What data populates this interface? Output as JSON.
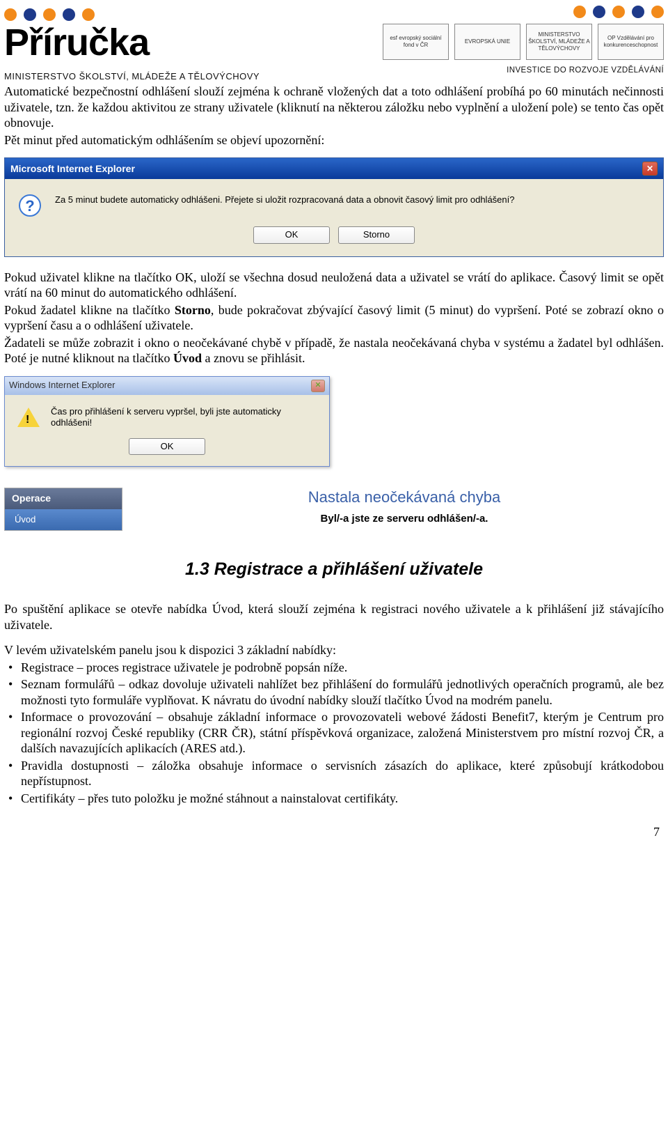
{
  "header": {
    "logo_text": "Příručka",
    "subtitle": "MINISTERSTVO ŠKOLSTVÍ, MLÁDEŽE A TĚLOVÝCHOVY",
    "invest_line": "INVESTICE DO ROZVOJE VZDĚLÁVÁNÍ",
    "sponsor_logos": [
      "esf evropský sociální fond v ČR",
      "EVROPSKÁ UNIE",
      "MINISTERSTVO ŠKOLSTVÍ, MLÁDEŽE A TĚLOVÝCHOVY",
      "OP Vzdělávání pro konkurenceschopnost"
    ]
  },
  "paras": {
    "p1": "Automatické bezpečnostní odhlášení slouží zejména k ochraně vložených dat a toto odhlášení probíhá po 60 minutách nečinnosti uživatele, tzn. že každou aktivitou ze strany uživatele (kliknutí na některou záložku nebo vyplnění a uložení pole) se tento čas opět obnovuje.",
    "p2": "Pět minut před automatickým odhlášením se objeví upozornění:",
    "p3a": "Pokud uživatel klikne na tlačítko OK, uloží se všechna dosud neuložená data a uživatel se vrátí do aplikace. Časový limit se opět vrátí na 60 minut do automatického odhlášení.",
    "p3b_pre": "Pokud žadatel klikne na tlačítko ",
    "p3b_bold": "Storno",
    "p3b_post": ", bude pokračovat zbývající časový limit (5 minut) do vypršení. Poté se zobrazí okno o vypršení času a o odhlášení uživatele.",
    "p3c_pre": "Žadateli se může zobrazit i okno o neočekávané chybě v případě, že nastala neočekávaná chyba v systému a žadatel byl odhlášen. Poté je nutné kliknout na tlačítko ",
    "p3c_bold": "Úvod",
    "p3c_post": " a znovu se přihlásit.",
    "p4": "Po spuštění aplikace se otevře nabídka Úvod, která slouží zejména k registraci nového uživatele a k přihlášení již stávajícího uživatele.",
    "p5": "V levém uživatelském panelu jsou k dispozici 3 základní nabídky:"
  },
  "dialog1": {
    "title": "Microsoft Internet Explorer",
    "message": "Za 5 minut budete automaticky odhlášeni. Přejete si uložit rozpracovaná data a obnovit časový limit pro odhlášení?",
    "ok": "OK",
    "cancel": "Storno"
  },
  "dialog2": {
    "title": "Windows Internet Explorer",
    "message": "Čas pro přihlášení k serveru vypršel, byli jste automaticky odhlášeni!",
    "ok": "OK"
  },
  "error_panel": {
    "op_header": "Operace",
    "op_item": "Úvod",
    "err_title": "Nastala neočekávaná chyba",
    "err_sub": "Byl/-a jste ze serveru odhlášen/-a."
  },
  "section": {
    "num": "1.3",
    "title": "Registrace a přihlášení uživatele"
  },
  "bullets": [
    "Registrace – proces registrace uživatele je podrobně popsán níže.",
    "Seznam formulářů – odkaz dovoluje uživateli nahlížet bez přihlášení do formulářů jednotlivých operačních programů, ale bez možnosti tyto formuláře vyplňovat. K návratu do úvodní nabídky slouží tlačítko Úvod na modrém panelu.",
    "Informace o provozování – obsahuje základní informace o provozovateli webové žádosti Benefit7, kterým je Centrum pro regionální rozvoj České republiky (CRR ČR), státní příspěvková organizace, založená Ministerstvem pro místní rozvoj ČR, a dalších navazujících aplikacích (ARES atd.).",
    "Pravidla dostupnosti – záložka obsahuje informace o servisních zásazích do aplikace, které způsobují krátkodobou nepřístupnost.",
    "Certifikáty – přes tuto položku je možné stáhnout a nainstalovat certifikáty."
  ],
  "page_number": "7"
}
